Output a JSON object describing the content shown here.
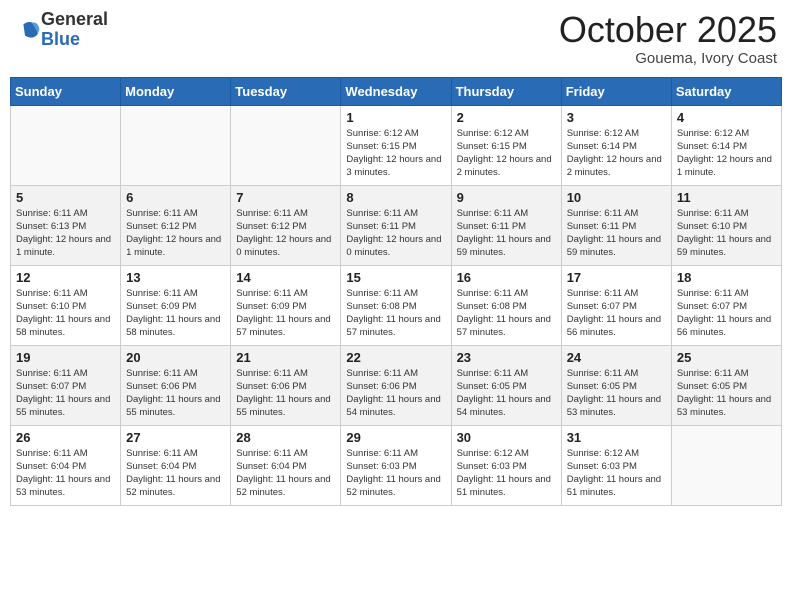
{
  "logo": {
    "general": "General",
    "blue": "Blue"
  },
  "title": "October 2025",
  "location": "Gouema, Ivory Coast",
  "days_of_week": [
    "Sunday",
    "Monday",
    "Tuesday",
    "Wednesday",
    "Thursday",
    "Friday",
    "Saturday"
  ],
  "weeks": [
    [
      {
        "day": "",
        "info": ""
      },
      {
        "day": "",
        "info": ""
      },
      {
        "day": "",
        "info": ""
      },
      {
        "day": "1",
        "info": "Sunrise: 6:12 AM\nSunset: 6:15 PM\nDaylight: 12 hours and 3 minutes."
      },
      {
        "day": "2",
        "info": "Sunrise: 6:12 AM\nSunset: 6:15 PM\nDaylight: 12 hours and 2 minutes."
      },
      {
        "day": "3",
        "info": "Sunrise: 6:12 AM\nSunset: 6:14 PM\nDaylight: 12 hours and 2 minutes."
      },
      {
        "day": "4",
        "info": "Sunrise: 6:12 AM\nSunset: 6:14 PM\nDaylight: 12 hours and 1 minute."
      }
    ],
    [
      {
        "day": "5",
        "info": "Sunrise: 6:11 AM\nSunset: 6:13 PM\nDaylight: 12 hours and 1 minute."
      },
      {
        "day": "6",
        "info": "Sunrise: 6:11 AM\nSunset: 6:12 PM\nDaylight: 12 hours and 1 minute."
      },
      {
        "day": "7",
        "info": "Sunrise: 6:11 AM\nSunset: 6:12 PM\nDaylight: 12 hours and 0 minutes."
      },
      {
        "day": "8",
        "info": "Sunrise: 6:11 AM\nSunset: 6:11 PM\nDaylight: 12 hours and 0 minutes."
      },
      {
        "day": "9",
        "info": "Sunrise: 6:11 AM\nSunset: 6:11 PM\nDaylight: 11 hours and 59 minutes."
      },
      {
        "day": "10",
        "info": "Sunrise: 6:11 AM\nSunset: 6:11 PM\nDaylight: 11 hours and 59 minutes."
      },
      {
        "day": "11",
        "info": "Sunrise: 6:11 AM\nSunset: 6:10 PM\nDaylight: 11 hours and 59 minutes."
      }
    ],
    [
      {
        "day": "12",
        "info": "Sunrise: 6:11 AM\nSunset: 6:10 PM\nDaylight: 11 hours and 58 minutes."
      },
      {
        "day": "13",
        "info": "Sunrise: 6:11 AM\nSunset: 6:09 PM\nDaylight: 11 hours and 58 minutes."
      },
      {
        "day": "14",
        "info": "Sunrise: 6:11 AM\nSunset: 6:09 PM\nDaylight: 11 hours and 57 minutes."
      },
      {
        "day": "15",
        "info": "Sunrise: 6:11 AM\nSunset: 6:08 PM\nDaylight: 11 hours and 57 minutes."
      },
      {
        "day": "16",
        "info": "Sunrise: 6:11 AM\nSunset: 6:08 PM\nDaylight: 11 hours and 57 minutes."
      },
      {
        "day": "17",
        "info": "Sunrise: 6:11 AM\nSunset: 6:07 PM\nDaylight: 11 hours and 56 minutes."
      },
      {
        "day": "18",
        "info": "Sunrise: 6:11 AM\nSunset: 6:07 PM\nDaylight: 11 hours and 56 minutes."
      }
    ],
    [
      {
        "day": "19",
        "info": "Sunrise: 6:11 AM\nSunset: 6:07 PM\nDaylight: 11 hours and 55 minutes."
      },
      {
        "day": "20",
        "info": "Sunrise: 6:11 AM\nSunset: 6:06 PM\nDaylight: 11 hours and 55 minutes."
      },
      {
        "day": "21",
        "info": "Sunrise: 6:11 AM\nSunset: 6:06 PM\nDaylight: 11 hours and 55 minutes."
      },
      {
        "day": "22",
        "info": "Sunrise: 6:11 AM\nSunset: 6:06 PM\nDaylight: 11 hours and 54 minutes."
      },
      {
        "day": "23",
        "info": "Sunrise: 6:11 AM\nSunset: 6:05 PM\nDaylight: 11 hours and 54 minutes."
      },
      {
        "day": "24",
        "info": "Sunrise: 6:11 AM\nSunset: 6:05 PM\nDaylight: 11 hours and 53 minutes."
      },
      {
        "day": "25",
        "info": "Sunrise: 6:11 AM\nSunset: 6:05 PM\nDaylight: 11 hours and 53 minutes."
      }
    ],
    [
      {
        "day": "26",
        "info": "Sunrise: 6:11 AM\nSunset: 6:04 PM\nDaylight: 11 hours and 53 minutes."
      },
      {
        "day": "27",
        "info": "Sunrise: 6:11 AM\nSunset: 6:04 PM\nDaylight: 11 hours and 52 minutes."
      },
      {
        "day": "28",
        "info": "Sunrise: 6:11 AM\nSunset: 6:04 PM\nDaylight: 11 hours and 52 minutes."
      },
      {
        "day": "29",
        "info": "Sunrise: 6:11 AM\nSunset: 6:03 PM\nDaylight: 11 hours and 52 minutes."
      },
      {
        "day": "30",
        "info": "Sunrise: 6:12 AM\nSunset: 6:03 PM\nDaylight: 11 hours and 51 minutes."
      },
      {
        "day": "31",
        "info": "Sunrise: 6:12 AM\nSunset: 6:03 PM\nDaylight: 11 hours and 51 minutes."
      },
      {
        "day": "",
        "info": ""
      }
    ]
  ]
}
